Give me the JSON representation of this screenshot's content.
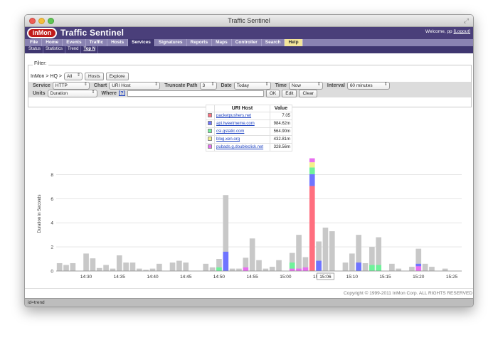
{
  "window": {
    "title": "Traffic Sentinel"
  },
  "header": {
    "logo": "inMon",
    "app_title": "Traffic Sentinel",
    "welcome_prefix": "Welcome, pp",
    "logout": "[Logout]"
  },
  "menu": [
    "File",
    "Home",
    "Events",
    "Traffic",
    "Hosts",
    "Services",
    "Signatures",
    "Reports",
    "Maps",
    "Controller",
    "Search",
    "Help"
  ],
  "submenu": [
    "Status",
    "Statistics",
    "Trend",
    "Top N"
  ],
  "filter": {
    "legend": "Filter:",
    "crumb_prefix": "InMon > HQ >",
    "crumb_select": "All",
    "hosts_button": "Hosts",
    "explore_button": "Explore",
    "service_label": "Service",
    "service_value": "HTTP",
    "chart_label": "Chart",
    "chart_value": "URI Host",
    "truncate_label": "Truncate Path",
    "truncate_value": "3",
    "date_label": "Date",
    "date_value": "Today",
    "time_label": "Time",
    "time_value": "Now",
    "interval_label": "Interval",
    "interval_value": "60 minutes",
    "units_label": "Units",
    "units_value": "Duration",
    "where_label": "Where",
    "where_help": "[?]",
    "ok_button": "OK",
    "edit_button": "Edit",
    "clear_button": "Clear"
  },
  "legend_table": {
    "col_host": "URI Host",
    "col_value": "Value",
    "rows": [
      {
        "host": "packetpushers.net",
        "value": "7.05",
        "color": "#ff6f7f"
      },
      {
        "host": "api.tweetmeme.com",
        "value": "984.62m",
        "color": "#6f74ff"
      },
      {
        "host": "csi.gstatic.com",
        "value": "564.90m",
        "color": "#6ff29a"
      },
      {
        "host": "blog.xen.org",
        "value": "432.81m",
        "color": "#f4f08a"
      },
      {
        "host": "pubads.g.doubleclick.net",
        "value": "328.56m",
        "color": "#e86ff0"
      }
    ]
  },
  "chart_data": {
    "type": "bar",
    "ylabel": "Duration in Seconds",
    "ylim": [
      0,
      9.5
    ],
    "yticks": [
      0,
      2,
      4,
      6,
      8
    ],
    "xticks": [
      "14:30",
      "14:35",
      "14:40",
      "14:45",
      "14:50",
      "14:55",
      "15:00",
      "15:05",
      "15:10",
      "15:15",
      "15:20",
      "15:25"
    ],
    "x_start_minute": 25.5,
    "x_end_minute": 86.5,
    "highlight_tick": "15:06",
    "highlight_minute": 66,
    "other_color": "#c8c8c8",
    "bars": [
      {
        "minute": 26,
        "other": 0.65
      },
      {
        "minute": 27,
        "other": 0.5
      },
      {
        "minute": 28,
        "other": 0.65
      },
      {
        "minute": 30,
        "other": 1.45
      },
      {
        "minute": 31,
        "other": 1.05
      },
      {
        "minute": 32,
        "other": 0.25
      },
      {
        "minute": 33,
        "other": 0.5
      },
      {
        "minute": 34,
        "other": 0.2
      },
      {
        "minute": 35,
        "other": 1.3
      },
      {
        "minute": 36,
        "other": 0.7
      },
      {
        "minute": 37,
        "other": 0.7
      },
      {
        "minute": 38,
        "other": 0.2
      },
      {
        "minute": 39,
        "other": 0.1
      },
      {
        "minute": 40,
        "other": 0.2
      },
      {
        "minute": 41,
        "other": 0.6
      },
      {
        "minute": 43,
        "other": 0.7
      },
      {
        "minute": 44,
        "other": 0.85
      },
      {
        "minute": 45,
        "other": 0.7
      },
      {
        "minute": 48,
        "other": 0.6
      },
      {
        "minute": 49,
        "other": 0.3
      },
      {
        "minute": 50,
        "other": 1.0,
        "segs": [
          0,
          0,
          0.3,
          0,
          0
        ]
      },
      {
        "minute": 51,
        "other": 6.3,
        "segs": [
          0,
          1.6,
          0,
          0,
          0
        ]
      },
      {
        "minute": 52,
        "other": 0.2
      },
      {
        "minute": 53,
        "other": 0.2
      },
      {
        "minute": 54,
        "other": 1.1,
        "segs": [
          0,
          0,
          0,
          0,
          0.3
        ]
      },
      {
        "minute": 55,
        "other": 2.7
      },
      {
        "minute": 56,
        "other": 0.9
      },
      {
        "minute": 57,
        "other": 0.2
      },
      {
        "minute": 58,
        "other": 0.35
      },
      {
        "minute": 59,
        "other": 0.9
      },
      {
        "minute": 61,
        "other": 1.5,
        "segs": [
          0,
          0,
          0.5,
          0,
          0.2
        ]
      },
      {
        "minute": 62,
        "other": 3.0,
        "segs": [
          0,
          0,
          0,
          0,
          0.2
        ]
      },
      {
        "minute": 63,
        "other": 1.15,
        "segs": [
          0,
          0,
          0,
          0,
          0.3
        ]
      },
      {
        "minute": 64,
        "other": 0,
        "segs": [
          7.05,
          0.98,
          0.56,
          0.43,
          0.33
        ]
      },
      {
        "minute": 65,
        "other": 2.45,
        "segs": [
          0,
          0.85,
          0,
          0,
          0
        ]
      },
      {
        "minute": 66,
        "other": 3.6
      },
      {
        "minute": 67,
        "other": 3.3
      },
      {
        "minute": 69,
        "other": 0.7
      },
      {
        "minute": 70,
        "other": 1.45
      },
      {
        "minute": 71,
        "other": 3.0,
        "segs": [
          0,
          0.7,
          0,
          0,
          0
        ]
      },
      {
        "minute": 72,
        "other": 0.65
      },
      {
        "minute": 73,
        "other": 2.0,
        "segs": [
          0,
          0,
          0.5,
          0,
          0
        ]
      },
      {
        "minute": 74,
        "other": 2.8,
        "segs": [
          0,
          0,
          0.5,
          0,
          0
        ]
      },
      {
        "minute": 76,
        "other": 0.6
      },
      {
        "minute": 77,
        "other": 0.2
      },
      {
        "minute": 79,
        "other": 0.35
      },
      {
        "minute": 80,
        "other": 1.85,
        "segs": [
          0,
          0.2,
          0,
          0,
          0.4
        ]
      },
      {
        "minute": 81,
        "other": 0.6
      },
      {
        "minute": 82,
        "other": 0.35
      },
      {
        "minute": 84,
        "other": 0.2
      }
    ]
  },
  "footer": {
    "copyright": "Copyright © 1999-2011 InMon Corp. ALL RIGHTS RESERVED"
  },
  "statusbar": {
    "text": "id=trend"
  }
}
